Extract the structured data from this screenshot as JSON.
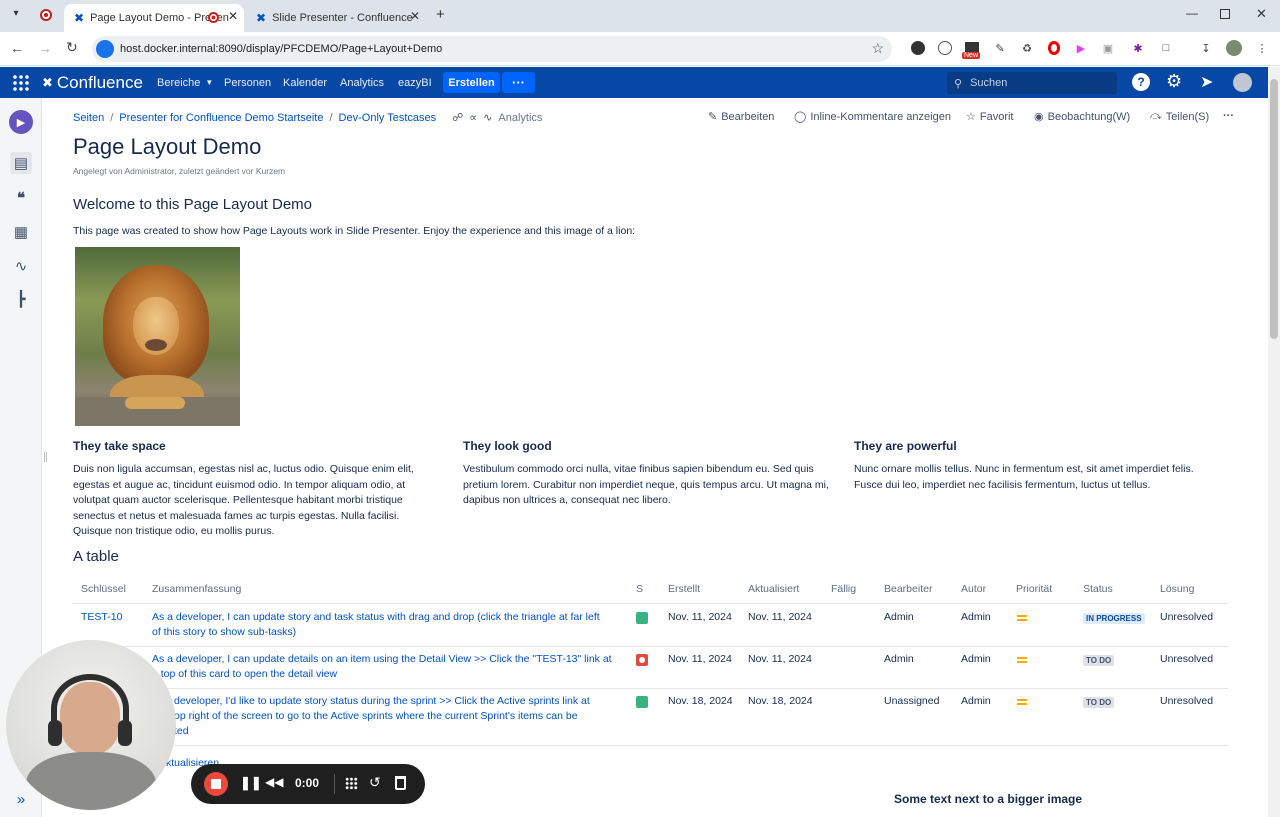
{
  "browser": {
    "tabs": [
      {
        "title": "Page Layout Demo - Presen"
      },
      {
        "title": "Slide Presenter - Confluence"
      }
    ],
    "url": "host.docker.internal:8090/display/PFCDEMO/Page+Layout+Demo",
    "new_badge": "New"
  },
  "nav": {
    "logo": "Confluence",
    "items": [
      "Bereiche",
      "Personen",
      "Kalender",
      "Analytics",
      "eazyBI"
    ],
    "create": "Erstellen",
    "more": "···",
    "search_placeholder": "Suchen"
  },
  "breadcrumb": [
    "Seiten",
    "Presenter for Confluence Demo Startseite",
    "Dev-Only Testcases"
  ],
  "analytics_label": "Analytics",
  "actions": {
    "edit": "Bearbeiten",
    "comments": "Inline-Kommentare anzeigen",
    "favorite": "Favorit",
    "watch": "Beobachtung(W)",
    "share": "Teilen(S)",
    "more": "···"
  },
  "page": {
    "title": "Page Layout Demo",
    "byline": "Angelegt von Administrator, zuletzt geändert vor Kurzem",
    "welcome_heading": "Welcome to this Page Layout Demo",
    "intro": "This page was created to show how Page Layouts work in Slide Presenter. Enjoy the experience and this image of a lion:",
    "columns": [
      {
        "heading": "They take space",
        "text": "Duis non ligula accumsan, egestas nisl ac, luctus odio. Quisque enim elit, egestas et augue ac, tincidunt euismod odio. In tempor aliquam odio, at volutpat quam auctor scelerisque. Pellentesque habitant morbi tristique senectus et netus et malesuada fames ac turpis egestas. Nulla facilisi. Quisque non tristique odio, eu mollis purus."
      },
      {
        "heading": "They look good",
        "text": "Vestibulum commodo orci nulla, vitae finibus sapien bibendum eu. Sed quis pretium lorem. Curabitur non imperdiet neque, quis tempus arcu. Ut magna mi, dapibus non ultrices a, consequat nec libero."
      },
      {
        "heading": "They are powerful",
        "text": "Nunc ornare mollis tellus. Nunc in fermentum est, sit amet imperdiet felis. Fusce dui leo, imperdiet nec facilisis fermentum, luctus ut tellus."
      }
    ],
    "table_heading": "A table",
    "bottom_heading": "Some text next to a bigger image",
    "refresh_link": "ktualisieren"
  },
  "table": {
    "headers": [
      "Schlüssel",
      "Zusammenfassung",
      "S",
      "Erstellt",
      "Aktualisiert",
      "Fällig",
      "Bearbeiter",
      "Autor",
      "Priorität",
      "Status",
      "Lösung"
    ],
    "rows": [
      {
        "key": "TEST-10",
        "summary1": "As a developer, I can update story and task status with drag and drop (click the triangle at far left",
        "summary2": "of this story to show sub-tasks)",
        "summary3": "",
        "created": "Nov. 11, 2024",
        "updated": "Nov. 11, 2024",
        "assignee": "Admin",
        "author": "Admin",
        "status": "IN PROGRESS",
        "resolution": "Unresolved"
      },
      {
        "key": "",
        "summary1": "As a developer, I can update details on an item using the Detail View >> Click the \"TEST-13\" link at",
        "summary2": "e top of this card to open the detail view",
        "summary3": "",
        "created": "Nov. 11, 2024",
        "updated": "Nov. 11, 2024",
        "assignee": "Admin",
        "author": "Admin",
        "status": "TO DO",
        "resolution": "Unresolved"
      },
      {
        "key": "",
        "summary1": "developer, I'd like to update story status during the sprint >> Click the Active sprints link at",
        "summary2": "op right of the screen to go to the Active sprints where the current Sprint's items can be",
        "summary3": "ted",
        "created": "Nov. 18, 2024",
        "updated": "Nov. 18, 2024",
        "assignee": "Unassigned",
        "author": "Admin",
        "status": "TO DO",
        "resolution": "Unresolved"
      }
    ]
  },
  "recorder": {
    "time": "0:00"
  },
  "colors": {
    "nav": "#0747a6",
    "create": "#0065ff",
    "link": "#0052cc",
    "story": "#36b37e",
    "bug": "#e5493a",
    "inprogress": "#deebff"
  }
}
